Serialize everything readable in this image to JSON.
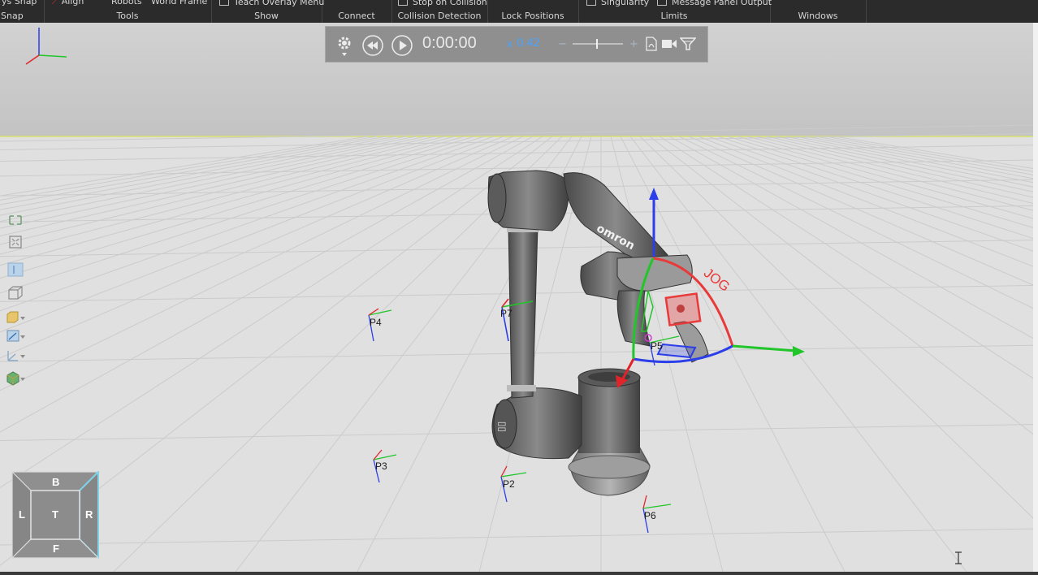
{
  "ribbon": {
    "groups": [
      {
        "label": "Snap",
        "items": [
          "ys Snap"
        ]
      },
      {
        "label": "Tools",
        "items": [
          "Align",
          "Robots",
          "World Frame"
        ]
      },
      {
        "label": "Show",
        "items": [
          "Teach Overlay Menu"
        ]
      },
      {
        "label": "Connect",
        "items": []
      },
      {
        "label": "Collision Detection",
        "items": [
          "Stop on Collision"
        ]
      },
      {
        "label": "Lock Positions",
        "items": []
      },
      {
        "label": "Limits",
        "items": [
          "Singularity",
          "Message Panel Output"
        ]
      },
      {
        "label": "Windows",
        "items": []
      }
    ]
  },
  "playback": {
    "time": "0:00:00",
    "speed_prefix": "x",
    "speed": "0.42"
  },
  "jog_label": "JOG",
  "points": [
    "P4",
    "P7",
    "P5",
    "P3",
    "P2",
    "P6"
  ],
  "view_cube": {
    "top": "B",
    "left": "L",
    "center": "T",
    "right": "R",
    "bottom": "F"
  },
  "robot_brand": "omron",
  "colors": {
    "x_axis": "#e0242a",
    "y_axis": "#22c52a",
    "z_axis": "#2b3ee8",
    "jog": "#e83a3a",
    "speed": "#4aa3ff"
  }
}
